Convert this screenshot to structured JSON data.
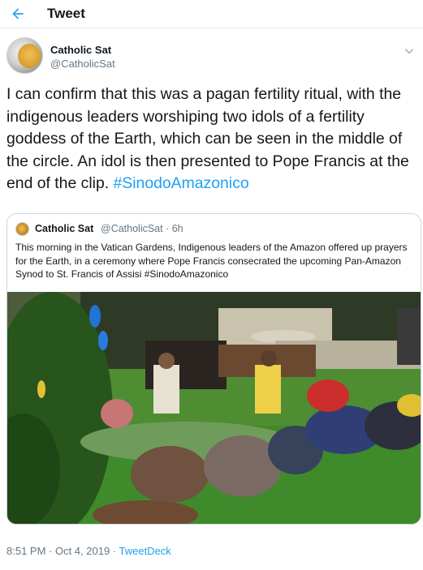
{
  "header": {
    "title": "Tweet",
    "back_icon": "arrow-left-icon"
  },
  "tweet": {
    "author_name": "Catholic Sat",
    "author_handle": "@CatholicSat",
    "avatar_text": "Catholic Sat",
    "text": "I can confirm that this was a pagan fertility ritual, with the indigenous leaders worshiping two idols of a fertility goddess of the Earth, which can be seen in the middle of the circle. An idol is then presented to Pope Francis at the end of the clip. ",
    "hashtag": "#SinodoAmazonico",
    "timestamp": "8:51 PM · Oct 4, 2019 · ",
    "source": "TweetDeck"
  },
  "quoted": {
    "author_name": "Catholic Sat",
    "meta": "@CatholicSat · 6h",
    "text": "This morning in the Vatican Gardens, Indigenous leaders of the Amazon offered up prayers for the Earth, in a ceremony where Pope Francis consecrated the upcoming Pan-Amazon Synod to St. Francis of Assisi #SinodoAmazonico"
  },
  "colors": {
    "accent": "#1da1f2",
    "text": "#14171a",
    "muted": "#657786",
    "border": "#ccd6dd"
  }
}
